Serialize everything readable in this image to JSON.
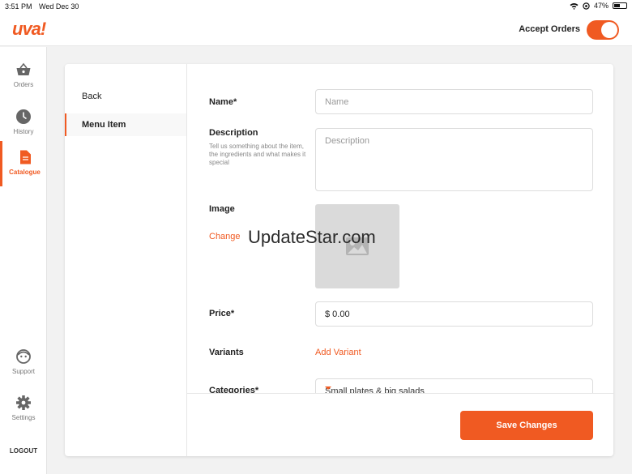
{
  "status_bar": {
    "time": "3:51 PM",
    "date": "Wed Dec 30",
    "battery": "47%"
  },
  "header": {
    "logo": "uva!",
    "accept_orders_label": "Accept Orders",
    "accept_orders_on": true
  },
  "sidebar": {
    "items": [
      {
        "label": "Orders",
        "icon": "basket-icon",
        "active": false
      },
      {
        "label": "History",
        "icon": "clock-icon",
        "active": false
      },
      {
        "label": "Catalogue",
        "icon": "document-icon",
        "active": true
      },
      {
        "label": "Support",
        "icon": "support-icon",
        "active": false
      },
      {
        "label": "Settings",
        "icon": "gear-icon",
        "active": false
      }
    ],
    "logout_label": "LOGOUT"
  },
  "subnav": {
    "back_label": "Back",
    "current_label": "Menu Item"
  },
  "form": {
    "name_label": "Name*",
    "name_placeholder": "Name",
    "description_label": "Description",
    "description_hint": "Tell us something about the item, the ingredients and what makes it special",
    "description_placeholder": "Description",
    "image_label": "Image",
    "image_change_label": "Change",
    "price_label": "Price*",
    "price_value": "$ 0.00",
    "variants_label": "Variants",
    "add_variant_label": "Add Variant",
    "categories_label": "Categories*",
    "categories_value": "Small plates & big salads"
  },
  "footer": {
    "save_label": "Save Changes"
  },
  "watermark": "UpdateStar.com",
  "colors": {
    "accent": "#f05a22",
    "background": "#f2f2f2"
  }
}
